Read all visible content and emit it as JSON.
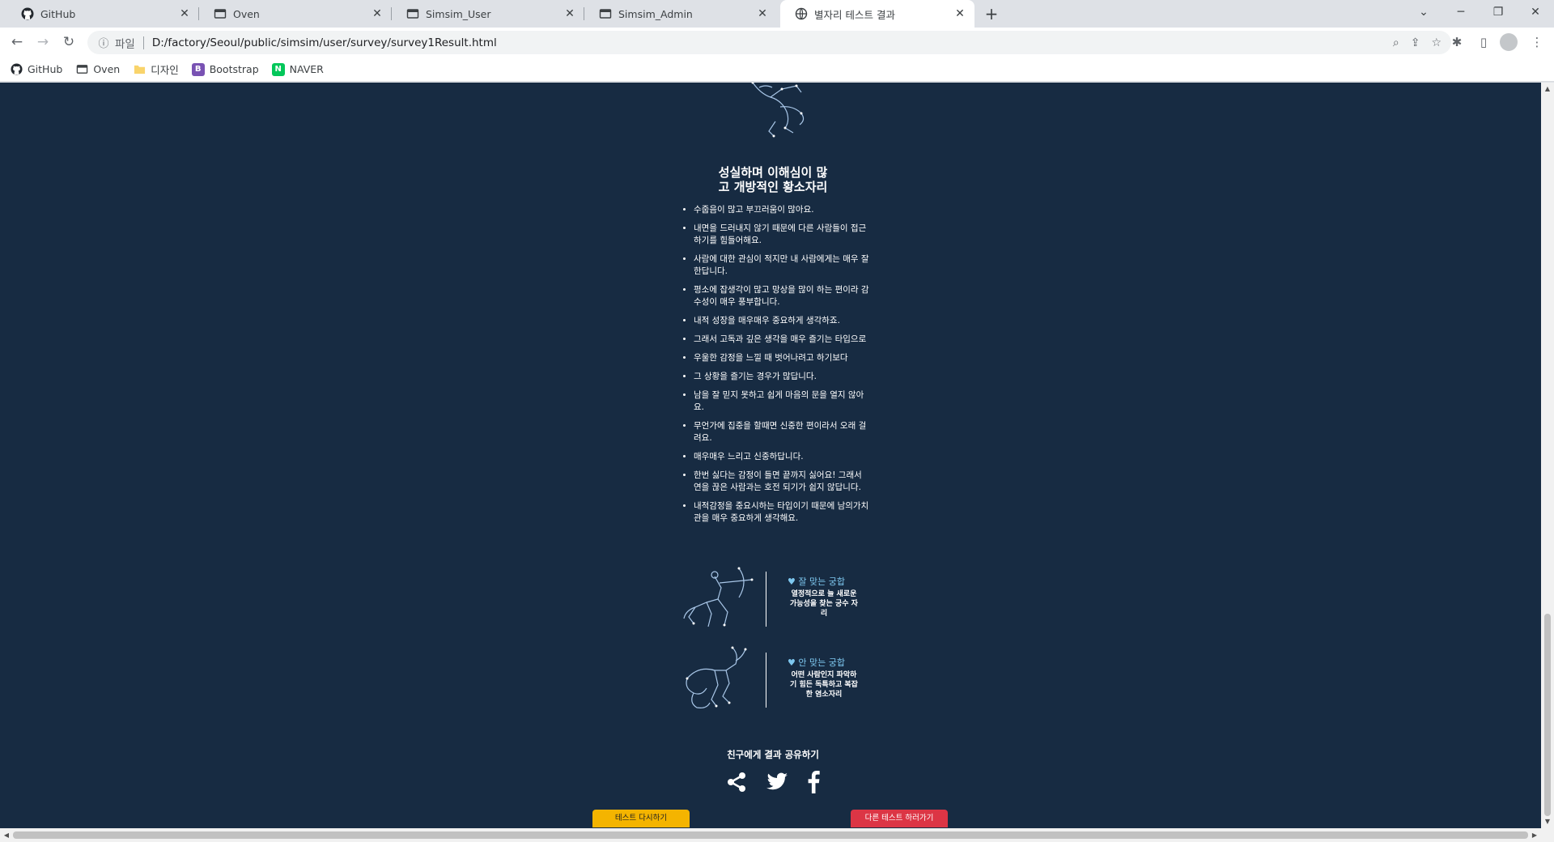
{
  "browser": {
    "tabs": [
      {
        "title": "GitHub",
        "icon": "github-icon"
      },
      {
        "title": "Oven",
        "icon": "page-icon"
      },
      {
        "title": "Simsim_User",
        "icon": "page-icon"
      },
      {
        "title": "Simsim_Admin",
        "icon": "page-icon"
      },
      {
        "title": "별자리 테스트 결과",
        "icon": "globe-icon",
        "active": true
      }
    ],
    "address": {
      "scheme": "파일",
      "url": "D:/factory/Seoul/public/simsim/user/survey/survey1Result.html"
    },
    "bookmarks": [
      {
        "label": "GitHub",
        "icon": "github-icon"
      },
      {
        "label": "Oven",
        "icon": "page-icon"
      },
      {
        "label": "디자인",
        "icon": "folder-icon"
      },
      {
        "label": "Bootstrap",
        "icon": "bootstrap-icon"
      },
      {
        "label": "NAVER",
        "icon": "naver-icon"
      }
    ]
  },
  "page": {
    "result_title_line1": "성실하며 이해심이 많",
    "result_title_line2": "고 개방적인 황소자리",
    "traits": [
      "수줍음이 많고 부끄러움이 많아요.",
      "내면을 드러내지 않기 때문에 다른 사람들이 접근하기를 힘들어해요.",
      "사람에 대한 관심이 적지만 내 사람에게는 매우 잘한답니다.",
      "평소에 잡생각이 많고 망상을 많이 하는 편이라 감수성이 매우 풍부합니다.",
      "내적 성장을 매우매우 중요하게 생각하죠.",
      "그래서 고독과 깊은 생각을 매우 즐기는 타입으로",
      "우울한 감정을 느낄 때 벗어나려고 하기보다",
      "그 상황을 즐기는 경우가 많답니다.",
      "남을 잘 믿지 못하고 쉽게 마음의 문을 열지 않아요.",
      "무언가에 집중을 할때면 신중한 편이라서 오래 걸려요.",
      "매우매우 느리고 신중하답니다.",
      "한번 싫다는 감정이 들면 끝까지 싫어요! 그래서 연을 끊은 사람과는 호전 되기가 쉽지 않답니다.",
      "내적감정을 중요시하는 타입이기 때문에 남의가치관을 매우 중요하게 생각해요."
    ],
    "good_match": {
      "label": "잘 맞는 궁합",
      "desc": "열정적으로 늘 새로운 가능성을 찾는 궁수 자리"
    },
    "bad_match": {
      "label": "안 맞는 궁합",
      "desc": "어떤 사람인지 파악하기 힘든 독특하고 복잡한 염소자리"
    },
    "share_title": "친구에게 결과 공유하기",
    "retry_button": "테스트 다시하기",
    "other_test_button": "다른 테스트 하러가기",
    "colors": {
      "background": "#172b42",
      "accent": "#7ec8f0",
      "retry": "#f4b400",
      "other": "#dc3545"
    }
  }
}
